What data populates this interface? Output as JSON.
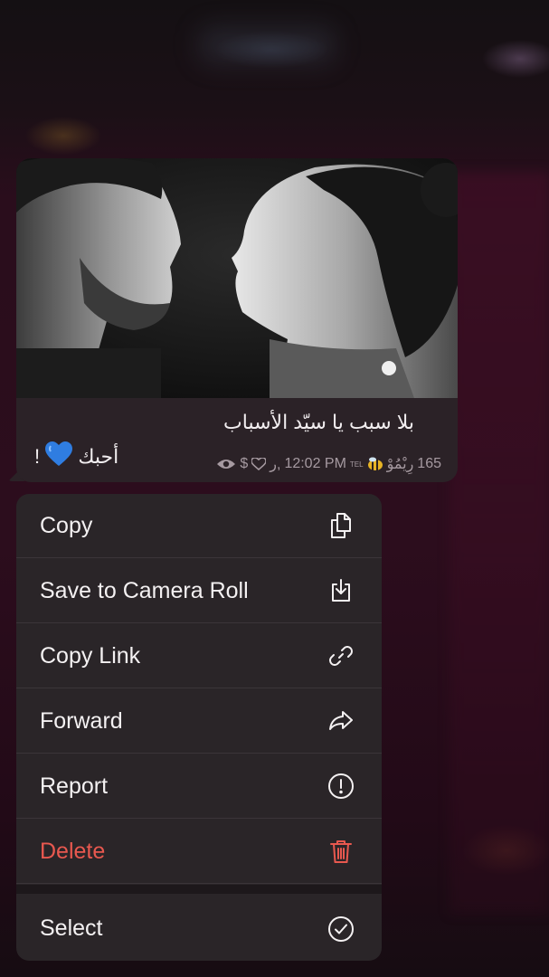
{
  "message": {
    "caption_main": "بلا سبب يا سيّد الأسباب",
    "caption_love": "أحبك",
    "caption_love_suffix": "!",
    "heart_icon": "blue-heart-emoji",
    "heart_color": "#2f7de1",
    "meta_views": "165",
    "meta_author": "رِيْمُوْ",
    "meta_author_badge": "TEL",
    "meta_time": "12:02 PM",
    "meta_suffix": "ر,"
  },
  "menu": {
    "items": [
      {
        "label": "Copy",
        "icon": "copy-icon"
      },
      {
        "label": "Save to Camera Roll",
        "icon": "save-download-icon"
      },
      {
        "label": "Copy Link",
        "icon": "link-icon"
      },
      {
        "label": "Forward",
        "icon": "forward-arrow-icon"
      },
      {
        "label": "Report",
        "icon": "exclamation-circle-icon"
      },
      {
        "label": "Delete",
        "icon": "trash-icon"
      },
      {
        "label": "Select",
        "icon": "checkmark-circle-icon"
      }
    ],
    "danger_color": "#e8584f"
  }
}
